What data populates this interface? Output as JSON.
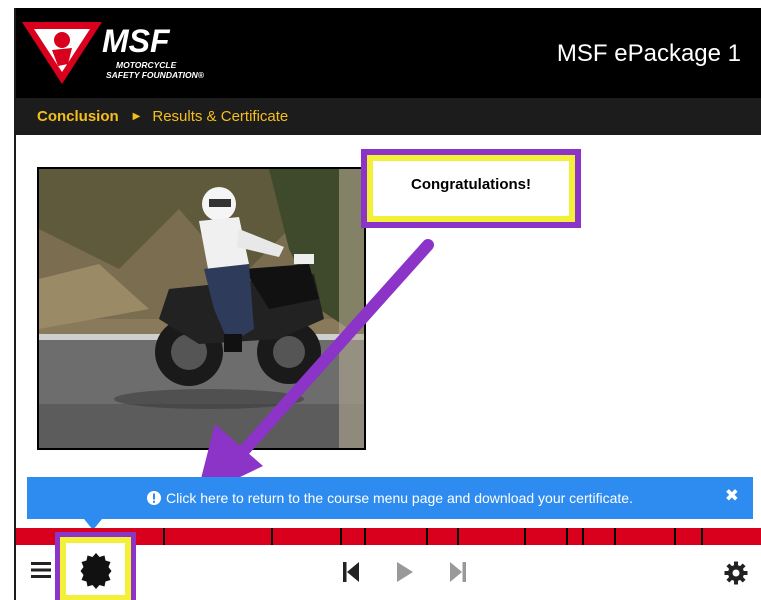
{
  "header": {
    "logo_text": "MSF",
    "logo_subtitle_line1": "MOTORCYCLE",
    "logo_subtitle_line2": "SAFETY FOUNDATION®",
    "app_title": "MSF ePackage 1"
  },
  "breadcrumb": {
    "section": "Conclusion",
    "page": "Results & Certificate"
  },
  "content": {
    "congratulations": "Congratulations!"
  },
  "tooltip": {
    "text": "Click here to return to the course menu page and download your certificate.",
    "close_glyph": "✖"
  },
  "colors": {
    "accent_yellow": "#f5bf1b",
    "highlight_purple": "#8c33c8",
    "highlight_yellow": "#f3f03a",
    "tooltip_blue": "#2e8cf0",
    "progress_red": "#d8001d"
  },
  "icons": [
    "menu-icon",
    "certificate-icon",
    "first-page-icon",
    "play-icon",
    "next-page-icon",
    "settings-gear-icon",
    "info-icon",
    "close-icon"
  ]
}
